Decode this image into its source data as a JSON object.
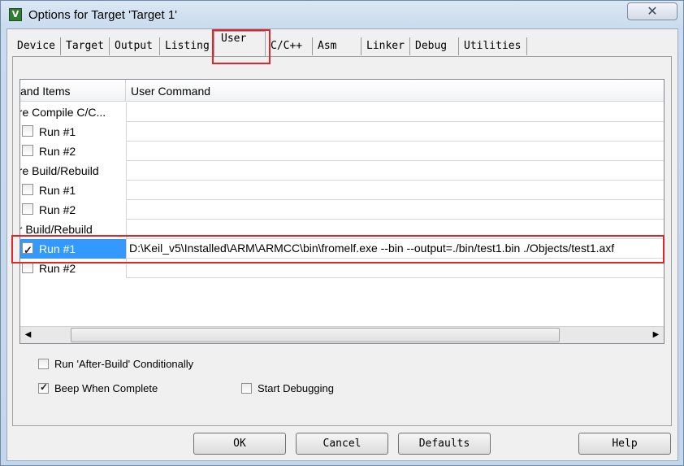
{
  "window": {
    "title": "Options for Target 'Target 1'",
    "close_glyph": "✕",
    "app_icon_glyph": "V"
  },
  "tabs": [
    {
      "label": "Device"
    },
    {
      "label": "Target"
    },
    {
      "label": "Output"
    },
    {
      "label": "Listing"
    },
    {
      "label": "User",
      "active": true
    },
    {
      "label": "C/C++"
    },
    {
      "label": "Asm"
    },
    {
      "label": "Linker"
    },
    {
      "label": "Debug"
    },
    {
      "label": "Utilities"
    }
  ],
  "grid": {
    "columns": {
      "items": "and Items",
      "command": "User Command"
    },
    "rows": [
      {
        "type": "group",
        "label": "ore Compile C/C..."
      },
      {
        "type": "run",
        "label": "Run #1",
        "checked": false,
        "command": ""
      },
      {
        "type": "run",
        "label": "Run #2",
        "checked": false,
        "command": ""
      },
      {
        "type": "group",
        "label": "ore Build/Rebuild"
      },
      {
        "type": "run",
        "label": "Run #1",
        "checked": false,
        "command": ""
      },
      {
        "type": "run",
        "label": "Run #2",
        "checked": false,
        "command": ""
      },
      {
        "type": "group",
        "label": "er Build/Rebuild"
      },
      {
        "type": "run",
        "label": "Run #1",
        "checked": true,
        "selected": true,
        "command": "D:\\Keil_v5\\Installed\\ARM\\ARMCC\\bin\\fromelf.exe --bin --output=./bin/test1.bin ./Objects/test1.axf"
      },
      {
        "type": "run",
        "label": "Run #2",
        "checked": false,
        "command": ""
      }
    ],
    "scroll_left": "◀",
    "scroll_right": "▶"
  },
  "options": {
    "run_after_build": {
      "label": "Run 'After-Build' Conditionally",
      "checked": false
    },
    "beep_when_complete": {
      "label": "Beep When Complete",
      "checked": true
    },
    "start_debugging": {
      "label": "Start Debugging",
      "checked": false
    }
  },
  "buttons": {
    "ok": "OK",
    "cancel": "Cancel",
    "defaults": "Defaults",
    "help": "Help"
  },
  "colors": {
    "highlight_annotation": "#e0262a",
    "selection": "#3399ff"
  }
}
